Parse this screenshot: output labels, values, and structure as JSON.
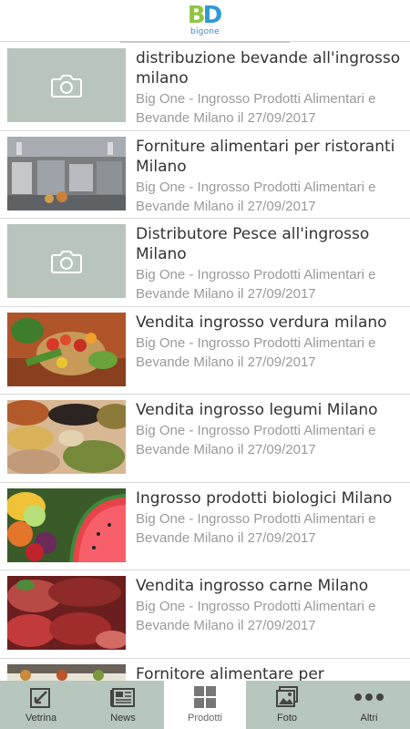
{
  "header": {
    "logo_mark_b": "B",
    "logo_mark_d": "D",
    "logo_text": "bigone",
    "colors": {
      "green": "#8fc541",
      "blue": "#2e9ad6"
    }
  },
  "list": [
    {
      "title": "distribuzione bevande all'ingrosso milano",
      "meta": "Big One - Ingrosso Prodotti Alimentari e Bevande Milano il 27/09/2017",
      "thumb": "placeholder"
    },
    {
      "title": "Forniture alimentari per ristoranti Milano",
      "meta": "Big One - Ingrosso Prodotti Alimentari e Bevande Milano il 27/09/2017",
      "thumb": "kitchen"
    },
    {
      "title": "Distributore Pesce all'ingrosso Milano",
      "meta": "Big One - Ingrosso Prodotti Alimentari e Bevande Milano il 27/09/2017",
      "thumb": "placeholder"
    },
    {
      "title": "Vendita ingrosso verdura milano",
      "meta": "Big One - Ingrosso Prodotti Alimentari e Bevande Milano il 27/09/2017",
      "thumb": "vegetables"
    },
    {
      "title": "Vendita ingrosso legumi Milano",
      "meta": "Big One - Ingrosso Prodotti Alimentari e Bevande Milano il 27/09/2017",
      "thumb": "legumes"
    },
    {
      "title": "Ingrosso prodotti biologici Milano",
      "meta": "Big One - Ingrosso Prodotti Alimentari e Bevande Milano il 27/09/2017",
      "thumb": "fruit"
    },
    {
      "title": "Vendita ingrosso carne Milano",
      "meta": "Big One - Ingrosso Prodotti Alimentari e Bevande Milano il 27/09/2017",
      "thumb": "meat"
    },
    {
      "title": "Fornitore alimentare per supermercati",
      "meta": "",
      "thumb": "market"
    }
  ],
  "tabs": [
    {
      "label": "Vetrina",
      "icon": "showcase-icon",
      "active": false
    },
    {
      "label": "News",
      "icon": "news-icon",
      "active": false
    },
    {
      "label": "Prodotti",
      "icon": "grid-icon",
      "active": true
    },
    {
      "label": "Foto",
      "icon": "photo-icon",
      "active": false
    },
    {
      "label": "Altri",
      "icon": "more-icon",
      "active": false
    }
  ]
}
